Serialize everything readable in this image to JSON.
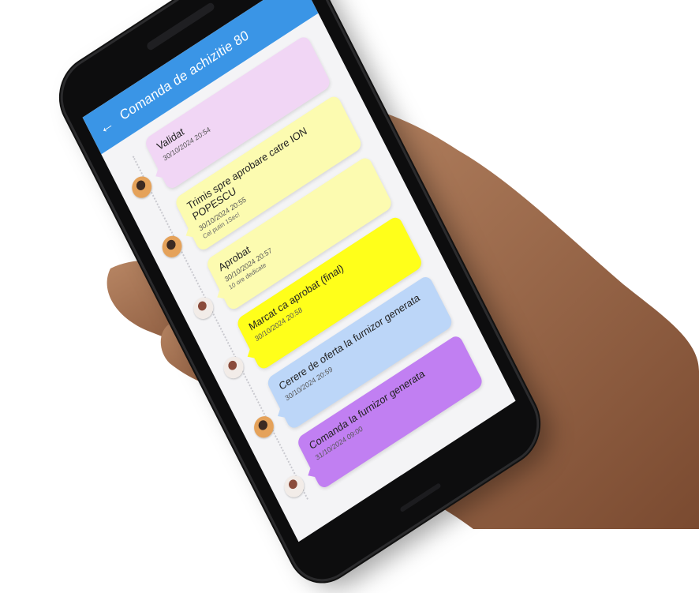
{
  "app": {
    "title": "Comanda de achizitie 80"
  },
  "timeline": [
    {
      "title": "Validat",
      "date": "30/10/2024 20:54",
      "note": "",
      "color": "#f1d6f5",
      "avatar": "person-1"
    },
    {
      "title": "Trimis spre aprobare catre ION POPESCU",
      "date": "30/10/2024 20:55",
      "note": "Cel putin 1Sec!",
      "color": "#fcfbb0",
      "avatar": "person-1"
    },
    {
      "title": "Aprobat",
      "date": "30/10/2024 20:57",
      "note": "10 ore dedicate",
      "color": "#fcfbb0",
      "avatar": "person-2"
    },
    {
      "title": "Marcat ca aprobat (final)",
      "date": "30/10/2024 20:58",
      "note": "",
      "color": "#ffff1a",
      "avatar": "person-2"
    },
    {
      "title": "Cerere de oferta la furnizor generata",
      "date": "30/10/2024 20:59",
      "note": "",
      "color": "#bcd6f8",
      "avatar": "person-1"
    },
    {
      "title": "Comanda la furnizor generata",
      "date": "31/10/2024 09:00",
      "note": "",
      "color": "#c17ff2",
      "avatar": "person-2"
    }
  ]
}
